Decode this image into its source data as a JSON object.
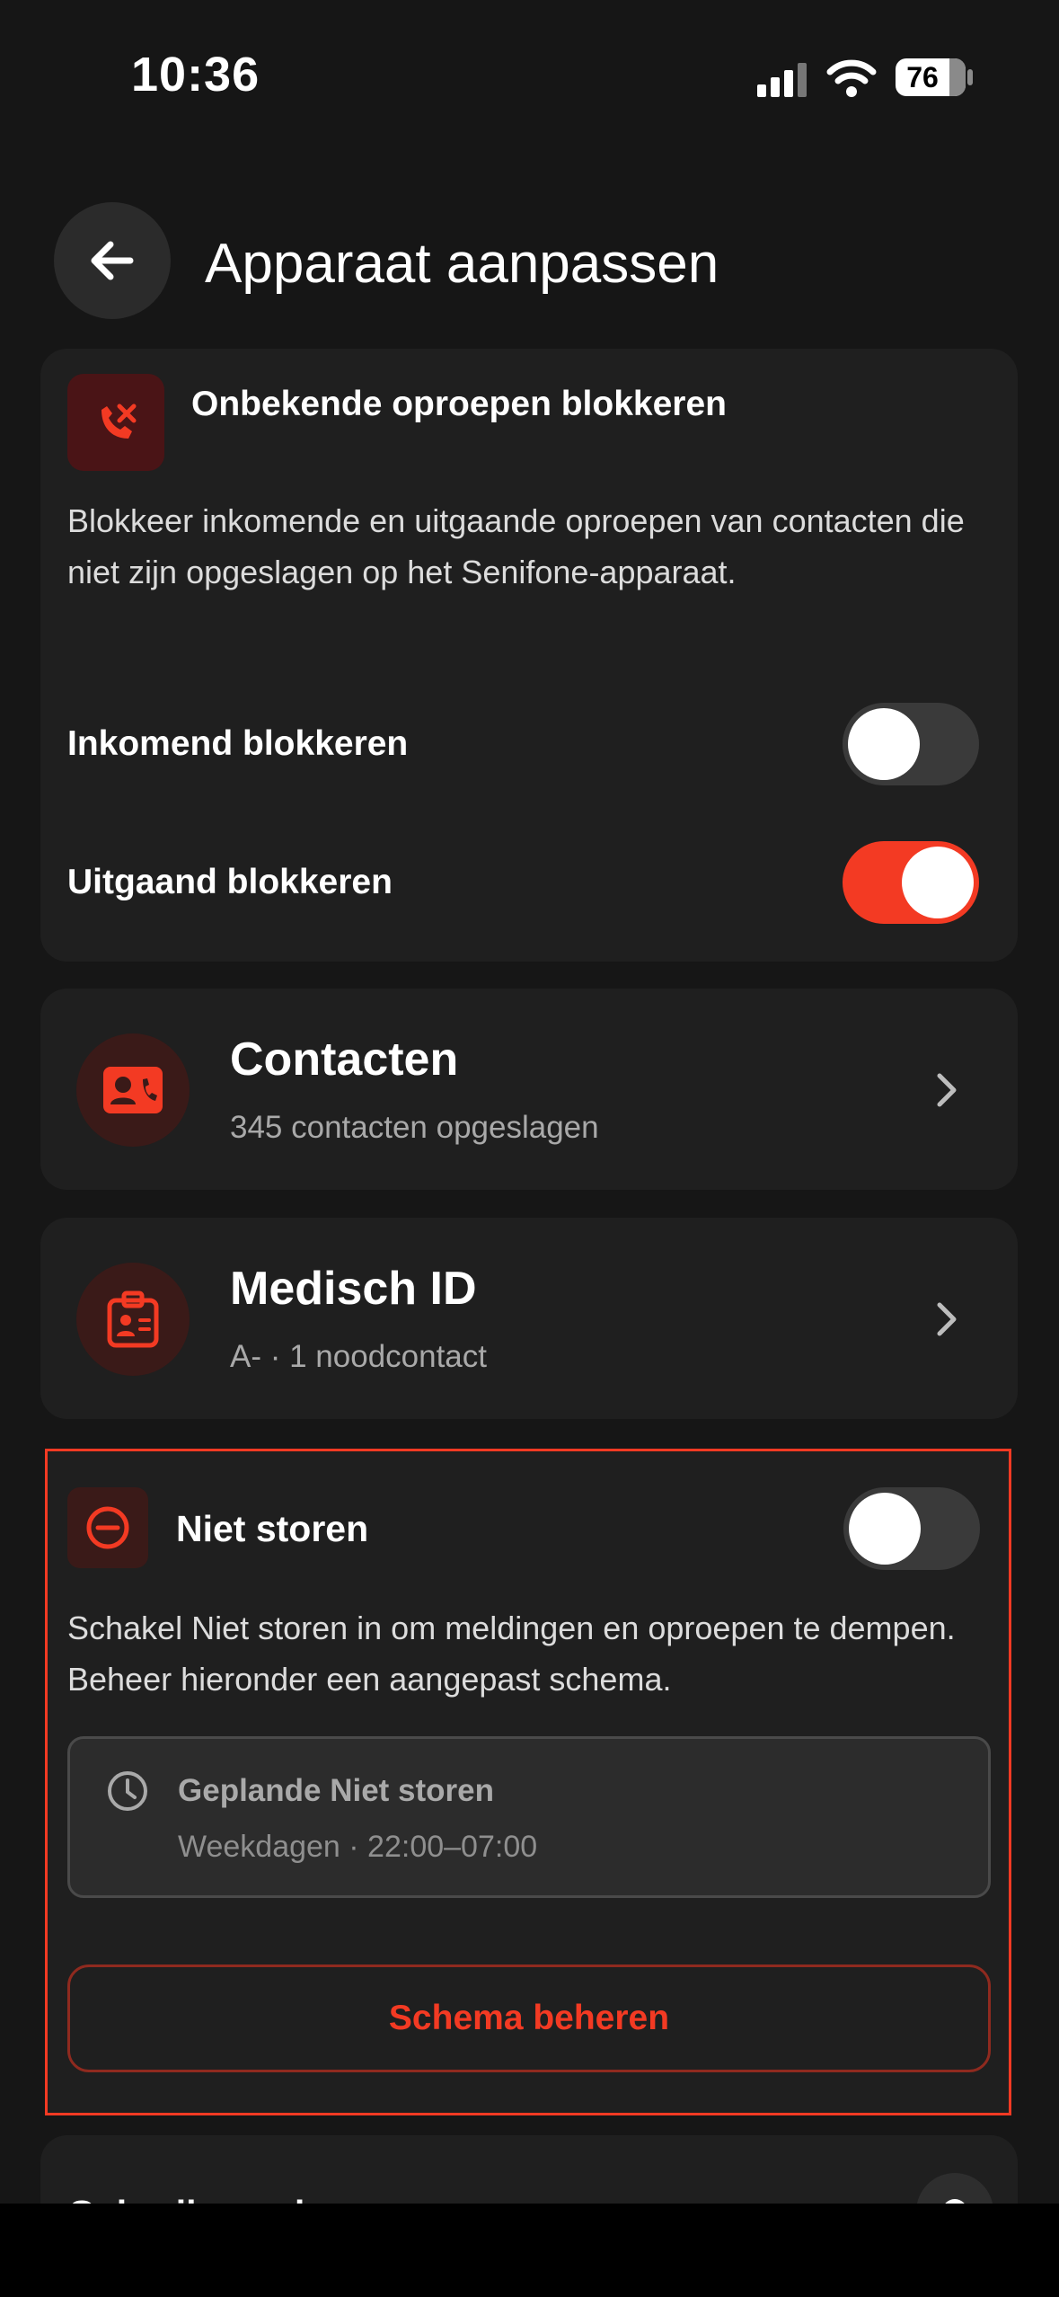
{
  "status_bar": {
    "time": "10:36",
    "battery": "76"
  },
  "header": {
    "title": "Apparaat aanpassen"
  },
  "block_calls": {
    "title": "Onbekende oproepen blokkeren",
    "description": "Blokkeer inkomende en uitgaande oproepen van contacten die niet zijn opgeslagen op het Senifone-apparaat.",
    "incoming_label": "Inkomend blokkeren",
    "incoming_on": false,
    "outgoing_label": "Uitgaand blokkeren",
    "outgoing_on": true
  },
  "contacts": {
    "title": "Contacten",
    "subtitle": "345 contacten opgeslagen"
  },
  "medical": {
    "title": "Medisch ID",
    "subtitle": "A- · 1 noodcontact"
  },
  "dnd": {
    "title": "Niet storen",
    "enabled": false,
    "description": "Schakel Niet storen in om meldingen en oproepen te dempen. Beheer hieronder een aangepast schema.",
    "schedule_title": "Geplande Niet storen",
    "schedule_subtitle": "Weekdagen · 22:00–07:00",
    "manage_button": "Schema beheren"
  },
  "next_section": {
    "title": "Gebruiksmodus"
  },
  "colors": {
    "accent": "#f33a23",
    "background": "#161616",
    "card": "#1f1f1f"
  }
}
